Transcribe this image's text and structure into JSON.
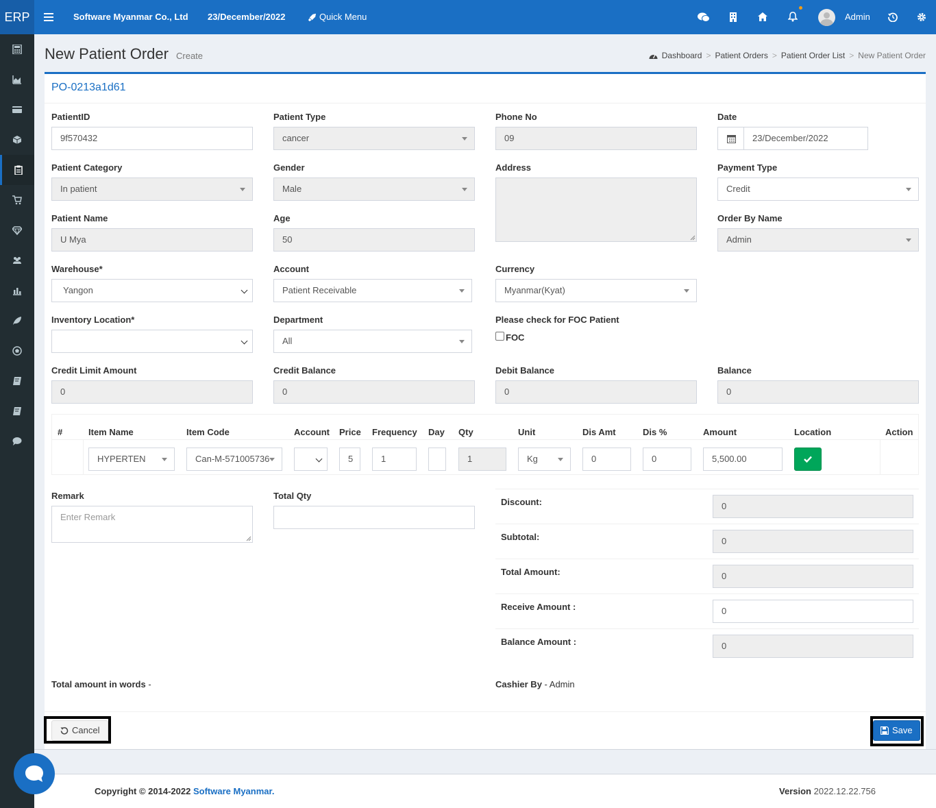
{
  "topbar": {
    "logo": "ERP",
    "company": "Software Myanmar Co., Ltd",
    "date": "23/December/2022",
    "quick_menu": "Quick Menu",
    "user": "Admin"
  },
  "sidebar_icons": [
    "calculator-icon",
    "chart-area-icon",
    "credit-card-icon",
    "cube-icon",
    "clipboard-icon",
    "cart-icon",
    "diamond-icon",
    "users-icon",
    "bar-chart-icon",
    "leaf-icon",
    "soccer-icon",
    "book-icon",
    "book-icon",
    "comment-icon"
  ],
  "page": {
    "title": "New Patient Order",
    "subtitle": "Create",
    "breadcrumb": [
      "Dashboard",
      "Patient Orders",
      "Patient Order List",
      "New Patient Order"
    ]
  },
  "order": {
    "code": "PO-0213a1d61",
    "fields": {
      "patient_id": {
        "label": "PatientID",
        "value": "9f570432"
      },
      "patient_type": {
        "label": "Patient Type",
        "value": "cancer"
      },
      "phone": {
        "label": "Phone No",
        "value": "09"
      },
      "date": {
        "label": "Date",
        "value": "23/December/2022"
      },
      "patient_category": {
        "label": "Patient Category",
        "value": "In patient"
      },
      "gender": {
        "label": "Gender",
        "value": "Male"
      },
      "address": {
        "label": "Address",
        "value": ""
      },
      "payment_type": {
        "label": "Payment Type",
        "value": "Credit"
      },
      "patient_name": {
        "label": "Patient Name",
        "value": "U Mya"
      },
      "age": {
        "label": "Age",
        "value": "50"
      },
      "order_by": {
        "label": "Order By Name",
        "value": "Admin"
      },
      "warehouse": {
        "label": "Warehouse*",
        "value": "Yangon"
      },
      "account": {
        "label": "Account",
        "value": "Patient Receivable"
      },
      "currency": {
        "label": "Currency",
        "value": "Myanmar(Kyat)"
      },
      "inventory_location": {
        "label": "Inventory Location*",
        "value": ""
      },
      "department": {
        "label": "Department",
        "value": "All"
      },
      "foc": {
        "label": "Please check for FOC Patient",
        "checkbox_label": "FOC"
      },
      "credit_limit": {
        "label": "Credit Limit Amount",
        "value": "0"
      },
      "credit_balance": {
        "label": "Credit Balance",
        "value": "0"
      },
      "debit_balance": {
        "label": "Debit Balance",
        "value": "0"
      },
      "balance": {
        "label": "Balance",
        "value": "0"
      }
    },
    "table": {
      "headers": [
        "#",
        "Item Name",
        "Item Code",
        "Account",
        "Price",
        "Frequency",
        "Day",
        "Qty",
        "Unit",
        "Dis Amt",
        "Dis %",
        "Amount",
        "Location",
        "Action"
      ],
      "row": {
        "item_name": "HYPERTEN",
        "item_code": "Can-M-571005736",
        "account": "",
        "price": "5",
        "frequency": "1",
        "day": "",
        "qty": "1",
        "unit": "Kg",
        "dis_amt": "0",
        "dis_pct": "0",
        "amount": "5,500.00"
      }
    },
    "remark": {
      "label": "Remark",
      "placeholder": "Enter Remark"
    },
    "total_qty": {
      "label": "Total Qty",
      "value": ""
    },
    "summary": {
      "discount": {
        "label": "Discount:",
        "value": "0"
      },
      "subtotal": {
        "label": "Subtotal:",
        "value": "0"
      },
      "total_amount": {
        "label": "Total Amount:",
        "value": "0"
      },
      "receive_amount": {
        "label": "Receive Amount :",
        "value": "0"
      },
      "balance_amount": {
        "label": "Balance Amount :",
        "value": "0"
      }
    },
    "words_label": "Total amount in words",
    "words_value": "-",
    "cashier_label": "Cashier By",
    "cashier_value": "- Admin"
  },
  "actions": {
    "cancel": "Cancel",
    "save": "Save"
  },
  "footer": {
    "copyright": "Copyright © 2014-2022",
    "brand": "Software Myanmar.",
    "version_label": "Version",
    "version": "2022.12.22.756"
  },
  "colors": {
    "primary": "#1a6fc4",
    "sidebar": "#222d32",
    "success": "#00a65a"
  }
}
